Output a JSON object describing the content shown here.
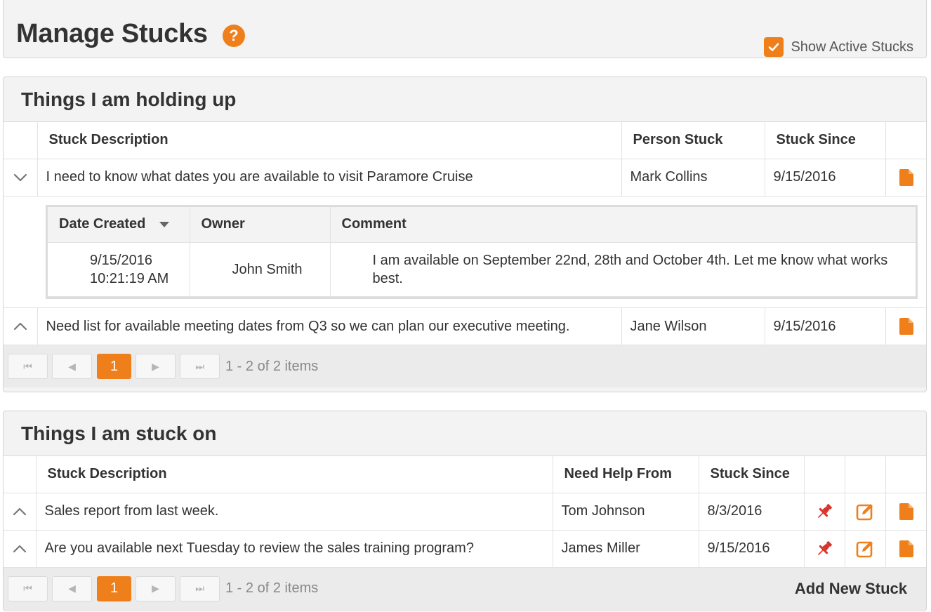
{
  "header": {
    "title": "Manage Stucks",
    "help_symbol": "?",
    "show_active_label": "Show Active Stucks",
    "show_active_checked": true
  },
  "holding_up": {
    "title": "Things I am holding up",
    "columns": [
      "Stuck Description",
      "Person Stuck",
      "Stuck Since"
    ],
    "rows": [
      {
        "description": "I need to know what dates you are available to visit Paramore Cruise",
        "person": "Mark Collins",
        "since": "9/15/2016",
        "expanded": true
      },
      {
        "description": "Need list for available meeting dates from Q3 so we can plan our executive meeting.",
        "person": "Jane Wilson",
        "since": "9/15/2016",
        "expanded": false
      }
    ],
    "detail": {
      "columns": [
        "Date Created",
        "Owner",
        "Comment"
      ],
      "rows": [
        {
          "date_line1": "9/15/2016",
          "date_line2": "10:21:19 AM",
          "owner": "John Smith",
          "comment": "I am available on September 22nd, 28th and October 4th. Let me know what works best."
        }
      ]
    },
    "pager": {
      "current_page": "1",
      "info": "1 - 2 of 2 items"
    }
  },
  "stuck_on": {
    "title": "Things I am stuck on",
    "columns": [
      "Stuck Description",
      "Need Help From",
      "Stuck Since"
    ],
    "rows": [
      {
        "description": "Sales report from last week.",
        "help_from": "Tom Johnson",
        "since": "8/3/2016"
      },
      {
        "description": "Are you available next Tuesday to review the sales training program?",
        "help_from": "James Miller",
        "since": "9/15/2016"
      }
    ],
    "pager": {
      "current_page": "1",
      "info": "1 - 2 of 2 items"
    },
    "add_new_label": "Add New Stuck"
  },
  "icons": {
    "expand": "chevron-down-icon",
    "collapse": "chevron-up-icon",
    "note": "document-icon",
    "pin": "pushpin-icon",
    "edit": "edit-icon"
  },
  "colors": {
    "accent": "#ef7f1a",
    "pin": "#d9342b",
    "panel_bg": "#f3f3f3"
  }
}
